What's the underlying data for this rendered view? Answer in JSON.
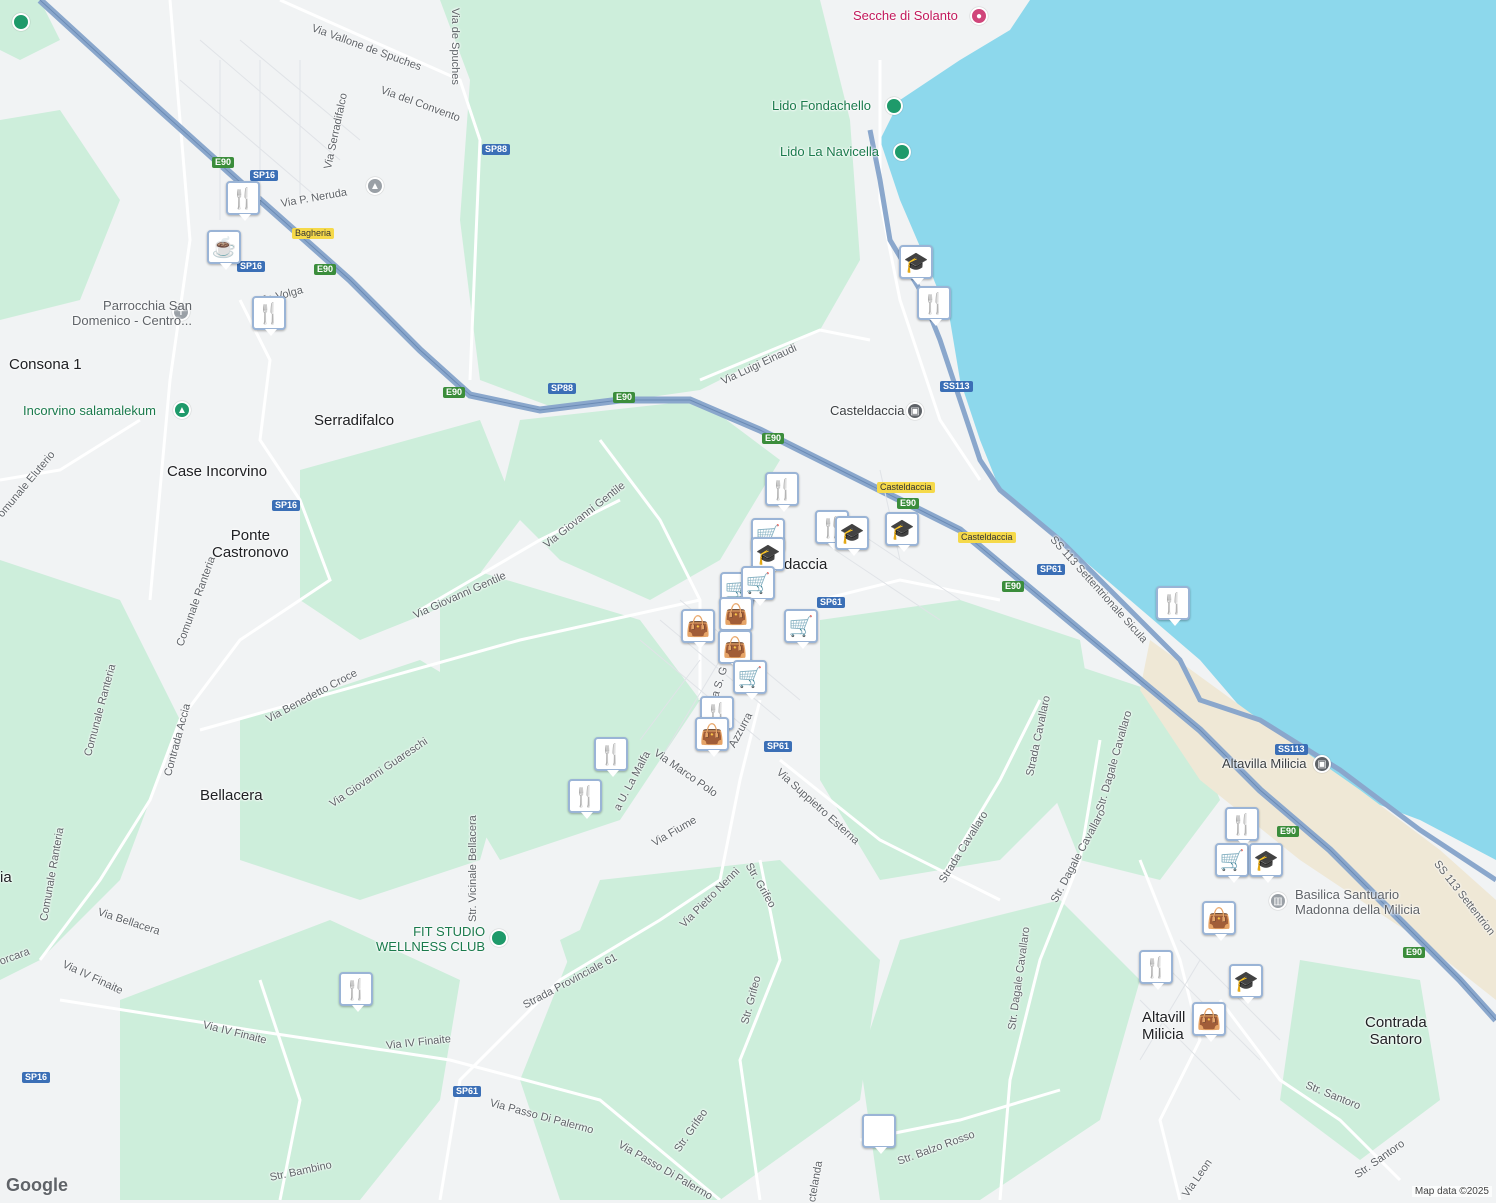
{
  "places": [
    {
      "id": "consona",
      "text": "Consona 1"
    },
    {
      "id": "serradifalco",
      "text": "Serradifalco"
    },
    {
      "id": "case-incorvino",
      "text": "Case Incorvino"
    },
    {
      "id": "ponte-castronovo",
      "text": "Ponte\nCastronovo"
    },
    {
      "id": "bellacera",
      "text": "Bellacera"
    },
    {
      "id": "casteldaccia-town",
      "text": "daccia"
    },
    {
      "id": "altavilla",
      "text": "Altavill\nMilicia"
    },
    {
      "id": "contrada-santoro",
      "text": "Contrada\nSantoro"
    },
    {
      "id": "left-edge-a",
      "text": "ia"
    }
  ],
  "roads": [
    {
      "id": "via-vallone",
      "text": "Via Vallone de Spuches"
    },
    {
      "id": "via-de-spuches",
      "text": "Via de Spuches"
    },
    {
      "id": "via-del-convento",
      "text": "Via del Convento"
    },
    {
      "id": "via-serradifalco",
      "text": "Via Serradifalco"
    },
    {
      "id": "via-neruda",
      "text": "Via P. Neruda"
    },
    {
      "id": "via-volga",
      "text": "Via Volga"
    },
    {
      "id": "via-luigi-einaudi",
      "text": "Via Luigi Einaudi"
    },
    {
      "id": "via-giovanni-gentile-1",
      "text": "Via Giovanni Gentile"
    },
    {
      "id": "via-giovanni-gentile-2",
      "text": "Via Giovanni Gentile"
    },
    {
      "id": "via-benedetto-croce",
      "text": "Via Benedetto Croce"
    },
    {
      "id": "via-giovanni-guareschi",
      "text": "Via Giovanni Guareschi"
    },
    {
      "id": "comunale-ranteria-1",
      "text": "Comunale Ranteria"
    },
    {
      "id": "comunale-ranteria-2",
      "text": "Comunale Ranteria"
    },
    {
      "id": "comunale-ranteria-3",
      "text": "Comunale Ranteria"
    },
    {
      "id": "contrada-accia",
      "text": "Contrada Accia"
    },
    {
      "id": "comunale-eluterio",
      "text": "omunale Eluterio"
    },
    {
      "id": "via-bellacera",
      "text": "Via Bellacera"
    },
    {
      "id": "via-iv-finaite-1",
      "text": "Via IV Finaite"
    },
    {
      "id": "via-iv-finaite-2",
      "text": "Via IV Finaite"
    },
    {
      "id": "via-iv-finaite-3",
      "text": "Via IV Finaite"
    },
    {
      "id": "orcara",
      "text": "orcara"
    },
    {
      "id": "str-vicinale-bellacera",
      "text": "Str. Vicinale Bellacera"
    },
    {
      "id": "via-u-la-malfa",
      "text": "a U. La Malfa"
    },
    {
      "id": "via-marco-polo",
      "text": "Via Marco Polo"
    },
    {
      "id": "via-fiume",
      "text": "Via Fiume"
    },
    {
      "id": "via-s-g",
      "text": "Via S. G"
    },
    {
      "id": "via-azzurra",
      "text": "Azzurra"
    },
    {
      "id": "via-suppietro",
      "text": "Via Suppietro Esterna"
    },
    {
      "id": "str-grifeo-1",
      "text": "Str. Grifeo"
    },
    {
      "id": "str-grifeo-2",
      "text": "Str. Grifeo"
    },
    {
      "id": "str-grifeo-3",
      "text": "Str. Grifeo"
    },
    {
      "id": "via-pietro-nenni",
      "text": "Via Pietro Nenni"
    },
    {
      "id": "strada-provinciale-61",
      "text": "Strada Provinciale 61"
    },
    {
      "id": "via-passo-di-palermo-1",
      "text": "Via Passo Di Palermo"
    },
    {
      "id": "via-passo-di-palermo-2",
      "text": "Via Passo Di Palermo"
    },
    {
      "id": "str-bambino",
      "text": "Str. Bambino"
    },
    {
      "id": "str-balzo-rosso",
      "text": "Str. Balzo Rosso"
    },
    {
      "id": "ctelanda",
      "text": "ctelanda"
    },
    {
      "id": "strada-cavallaro-1",
      "text": "Strada Cavallaro"
    },
    {
      "id": "strada-cavallaro-2",
      "text": "Strada Cavallaro"
    },
    {
      "id": "str-dagale-cavallaro-1",
      "text": "Str. Dagale Cavallaro"
    },
    {
      "id": "str-dagale-cavallaro-2",
      "text": "Str. Dagale Cavallaro"
    },
    {
      "id": "str-dagale-cavallaro-3",
      "text": "Str. Dagale Cavallaro"
    },
    {
      "id": "ss113-sicula",
      "text": "SS 113 Settentrionale Sicula"
    },
    {
      "id": "ss113-sett",
      "text": "SS 113 Settentrion"
    },
    {
      "id": "str-santoro-1",
      "text": "Str. Santoro"
    },
    {
      "id": "str-santoro-2",
      "text": "Str. Santoro"
    },
    {
      "id": "via-leon",
      "text": "Via Leon"
    }
  ],
  "pois": [
    {
      "id": "secche-solanto",
      "text": "Secche di Solanto"
    },
    {
      "id": "lido-fondachello",
      "text": "Lido Fondachello"
    },
    {
      "id": "lido-navicella",
      "text": "Lido La Navicella"
    },
    {
      "id": "parrocchia",
      "text": "Parrocchia San\nDomenico - Centro..."
    },
    {
      "id": "incorvino",
      "text": "Incorvino salamalekum"
    },
    {
      "id": "casteldaccia-station",
      "text": "Casteldaccia"
    },
    {
      "id": "altavilla-station",
      "text": "Altavilla Milicia"
    },
    {
      "id": "basilica",
      "text": "Basilica Santuario\nMadonna della Milicia"
    },
    {
      "id": "fit-studio",
      "text": "FIT STUDIO\nWELLNESS CLUB"
    }
  ],
  "shields": [
    {
      "id": "e90-a",
      "text": "E90",
      "kind": "e"
    },
    {
      "id": "sp16-a",
      "text": "SP16",
      "kind": "sp"
    },
    {
      "id": "bagheria",
      "text": "Bagheria",
      "kind": "town"
    },
    {
      "id": "sp16-b",
      "text": "SP16",
      "kind": "sp"
    },
    {
      "id": "e90-b",
      "text": "E90",
      "kind": "e"
    },
    {
      "id": "sp88-a",
      "text": "SP88",
      "kind": "sp"
    },
    {
      "id": "sp88-b",
      "text": "SP88",
      "kind": "sp"
    },
    {
      "id": "e90-c",
      "text": "E90",
      "kind": "e"
    },
    {
      "id": "e90-d",
      "text": "E90",
      "kind": "e"
    },
    {
      "id": "e90-e",
      "text": "E90",
      "kind": "e"
    },
    {
      "id": "sp16-c",
      "text": "SP16",
      "kind": "sp"
    },
    {
      "id": "ss113-a",
      "text": "SS113",
      "kind": "ss"
    },
    {
      "id": "casteldaccia-y1",
      "text": "Casteldaccia",
      "kind": "town"
    },
    {
      "id": "e90-f",
      "text": "E90",
      "kind": "e"
    },
    {
      "id": "casteldaccia-y2",
      "text": "Casteldaccia",
      "kind": "town"
    },
    {
      "id": "sp61-a",
      "text": "SP61",
      "kind": "sp"
    },
    {
      "id": "sp61-b",
      "text": "SP61",
      "kind": "sp"
    },
    {
      "id": "e90-g",
      "text": "E90",
      "kind": "e"
    },
    {
      "id": "sp61-c",
      "text": "SP61",
      "kind": "sp"
    },
    {
      "id": "ss113-b",
      "text": "SS113",
      "kind": "ss"
    },
    {
      "id": "e90-h",
      "text": "E90",
      "kind": "e"
    },
    {
      "id": "e90-i",
      "text": "E90",
      "kind": "e"
    },
    {
      "id": "sp16-d",
      "text": "SP16",
      "kind": "sp"
    },
    {
      "id": "sp61-d",
      "text": "SP61",
      "kind": "sp"
    }
  ],
  "markers": [
    {
      "id": "m1",
      "icon": "restaurant-icon",
      "glyph": "🍴"
    },
    {
      "id": "m2",
      "icon": "cafe-icon",
      "glyph": "☕"
    },
    {
      "id": "m3",
      "icon": "restaurant-icon",
      "glyph": "🍴"
    },
    {
      "id": "m4",
      "icon": "school-icon",
      "glyph": "🎓"
    },
    {
      "id": "m5",
      "icon": "restaurant-icon",
      "glyph": "🍴"
    },
    {
      "id": "m6",
      "icon": "restaurant-icon",
      "glyph": "🍴"
    },
    {
      "id": "m7",
      "icon": "grocery-icon",
      "glyph": "🛒"
    },
    {
      "id": "m8",
      "icon": "school-icon",
      "glyph": "🎓"
    },
    {
      "id": "m9",
      "icon": "restaurant-icon",
      "glyph": "🍴"
    },
    {
      "id": "m10",
      "icon": "school-icon",
      "glyph": "🎓"
    },
    {
      "id": "m11",
      "icon": "school-icon",
      "glyph": "🎓"
    },
    {
      "id": "m12",
      "icon": "grocery-icon",
      "glyph": "🛒"
    },
    {
      "id": "m13",
      "icon": "grocery-icon",
      "glyph": "🛒"
    },
    {
      "id": "m14",
      "icon": "shopping-bag-icon",
      "glyph": "👜"
    },
    {
      "id": "m15",
      "icon": "shopping-bag-icon",
      "glyph": "👜"
    },
    {
      "id": "m16",
      "icon": "grocery-icon",
      "glyph": "🛒"
    },
    {
      "id": "m17",
      "icon": "shopping-bag-icon",
      "glyph": "👜"
    },
    {
      "id": "m18",
      "icon": "grocery-icon",
      "glyph": "🛒"
    },
    {
      "id": "m19",
      "icon": "restaurant-icon",
      "glyph": "🍴"
    },
    {
      "id": "m20",
      "icon": "shopping-bag-icon",
      "glyph": "👜"
    },
    {
      "id": "m21",
      "icon": "restaurant-icon",
      "glyph": "🍴"
    },
    {
      "id": "m22",
      "icon": "restaurant-icon",
      "glyph": "🍴"
    },
    {
      "id": "m23",
      "icon": "restaurant-icon",
      "glyph": "🍴"
    },
    {
      "id": "m24",
      "icon": "restaurant-icon",
      "glyph": "🍴"
    },
    {
      "id": "m25",
      "icon": "restaurant-icon",
      "glyph": "🍴"
    },
    {
      "id": "m26",
      "icon": "grocery-icon",
      "glyph": "🛒"
    },
    {
      "id": "m27",
      "icon": "school-icon",
      "glyph": "🎓"
    },
    {
      "id": "m28",
      "icon": "shopping-bag-icon",
      "glyph": "👜"
    },
    {
      "id": "m29",
      "icon": "restaurant-icon",
      "glyph": "🍴"
    },
    {
      "id": "m30",
      "icon": "school-icon",
      "glyph": "🎓"
    },
    {
      "id": "m31",
      "icon": "shopping-bag-icon",
      "glyph": "👜"
    }
  ],
  "attribution": "Map data ©2025",
  "logo": "Google",
  "colors": {
    "sea": "#8dd8ec",
    "land": "#f1f3f4",
    "green": "#cdeedb",
    "highway": "#8aa7cc",
    "road": "#ffffff"
  }
}
